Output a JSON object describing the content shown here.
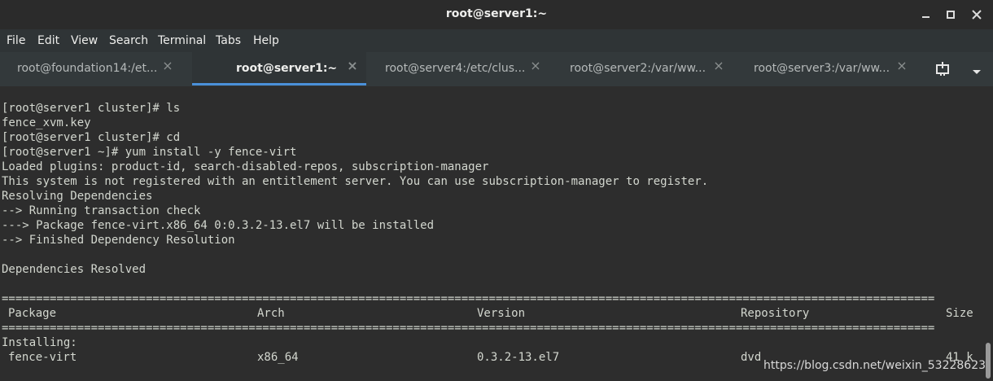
{
  "window": {
    "title": "root@server1:~",
    "controls": {
      "minimize": "–",
      "maximize": "□",
      "close": "✕"
    }
  },
  "menu": [
    "File",
    "Edit",
    "View",
    "Search",
    "Terminal",
    "Tabs",
    "Help"
  ],
  "tabs": [
    {
      "label": "root@foundation14:/et...",
      "close": "×",
      "active": false
    },
    {
      "label": "root@server1:~",
      "close": "×",
      "active": true
    },
    {
      "label": "root@server4:/etc/clus...",
      "close": "×",
      "active": false
    },
    {
      "label": "root@server2:/var/ww...",
      "close": "×",
      "active": false
    },
    {
      "label": "root@server3:/var/ww...",
      "close": "×",
      "active": false
    }
  ],
  "terminal": {
    "lines": [
      "[root@server1 cluster]# ls",
      "fence_xvm.key",
      "[root@server1 cluster]# cd",
      "[root@server1 ~]# yum install -y fence-virt",
      "Loaded plugins: product-id, search-disabled-repos, subscription-manager",
      "This system is not registered with an entitlement server. You can use subscription-manager to register.",
      "Resolving Dependencies",
      "--> Running transaction check",
      "---> Package fence-virt.x86_64 0:0.3.2-13.el7 will be installed",
      "--> Finished Dependency Resolution",
      "",
      "Dependencies Resolved",
      ""
    ],
    "rule": "========================================================================================================================================",
    "table_header": {
      "package": "Package",
      "arch": "Arch",
      "version": "Version",
      "repository": "Repository",
      "size": "Size"
    },
    "installing_label": "Installing:",
    "row": {
      "package": "fence-virt",
      "arch": "x86_64",
      "version": "0.3.2-13.el7",
      "repository": "dvd",
      "size": "41 k"
    }
  },
  "watermark": "https://blog.csdn.net/weixin_53228623"
}
